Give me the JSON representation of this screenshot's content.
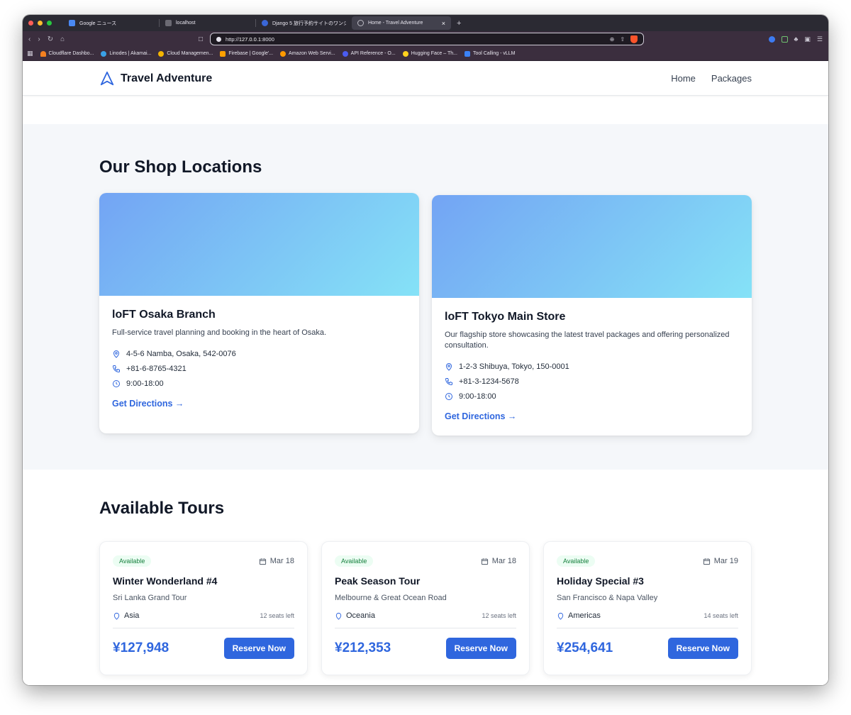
{
  "browser": {
    "tabs": [
      {
        "title": "Google ニュース",
        "active": false
      },
      {
        "title": "localhost",
        "active": false
      },
      {
        "title": "Django 5 旅行予約サイトのワンショ",
        "active": false
      },
      {
        "title": "Home - Travel Adventure",
        "active": true
      }
    ],
    "new_tab": "+",
    "close": "×",
    "url_prefix": "http://",
    "url_host": "127.0.0.1",
    "url_port": ":8000",
    "bookmarks": [
      {
        "label": "Cloudflare Dashbo...",
        "color": "#f38020"
      },
      {
        "label": "Linodes | Akamai...",
        "color": "#3aa1e6"
      },
      {
        "label": "Cloud Managemen...",
        "color": "#f4b400"
      },
      {
        "label": "Firebase | Google'...",
        "color": "#ffa000"
      },
      {
        "label": "Amazon Web Servi...",
        "color": "#ff9900"
      },
      {
        "label": "API Reference - O...",
        "color": "#4b5cf0"
      },
      {
        "label": "Hugging Face – Th...",
        "color": "#ffd21e"
      },
      {
        "label": "Tool Calling - vLLM",
        "color": "#3b82f6"
      }
    ]
  },
  "site": {
    "brand": "Travel Adventure",
    "nav": [
      "Home",
      "Packages"
    ],
    "accent": "#2f66de",
    "locations_title": "Our Shop Locations",
    "locations": [
      {
        "name": "loFT Osaka Branch",
        "description": "Full-service travel planning and booking in the heart of Osaka.",
        "address": "4-5-6 Namba, Osaka, 542-0076",
        "phone": "+81-6-8765-4321",
        "hours": "9:00-18:00",
        "link": "Get Directions →"
      },
      {
        "name": "loFT Tokyo Main Store",
        "description": "Our flagship store showcasing the latest travel packages and offering personalized consultation.",
        "address": "1-2-3 Shibuya, Tokyo, 150-0001",
        "phone": "+81-3-1234-5678",
        "hours": "9:00-18:00",
        "link": "Get Directions →"
      }
    ],
    "tours_title": "Available Tours",
    "tours": [
      {
        "badge": "Available",
        "date": "Mar 18",
        "name": "Winter Wonderland #4",
        "subtitle": "Sri Lanka Grand Tour",
        "region": "Asia",
        "seats": "12 seats left",
        "price": "¥127,948",
        "cta": "Reserve Now"
      },
      {
        "badge": "Available",
        "date": "Mar 18",
        "name": "Peak Season Tour",
        "subtitle": "Melbourne & Great Ocean Road",
        "region": "Oceania",
        "seats": "12 seats left",
        "price": "¥212,353",
        "cta": "Reserve Now"
      },
      {
        "badge": "Available",
        "date": "Mar 19",
        "name": "Holiday Special #3",
        "subtitle": "San Francisco & Napa Valley",
        "region": "Americas",
        "seats": "14 seats left",
        "price": "¥254,641",
        "cta": "Reserve Now"
      }
    ]
  }
}
